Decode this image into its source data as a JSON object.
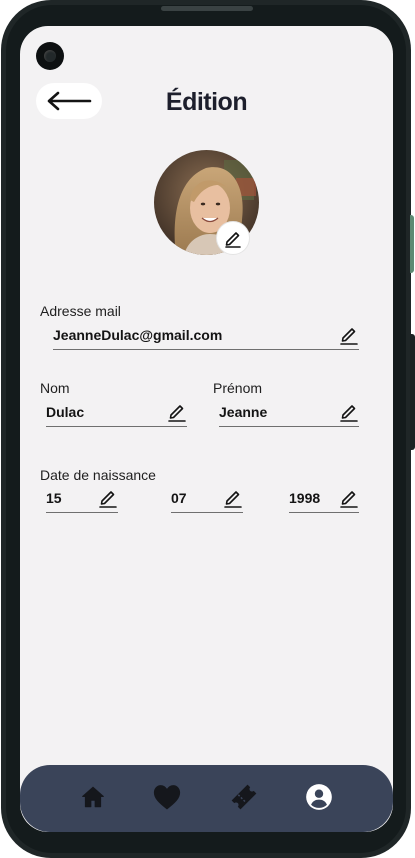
{
  "header": {
    "title": "Édition"
  },
  "icons": {
    "back": "arrow-left-icon",
    "edit": "pencil-icon",
    "home": "home-icon",
    "favorites": "heart-icon",
    "tickets": "ticket-icon",
    "profile": "user-circle-icon"
  },
  "profile": {
    "photo_alt": "Photo de profil"
  },
  "form": {
    "email": {
      "label": "Adresse mail",
      "value": "JeanneDulac@gmail.com"
    },
    "last_name": {
      "label": "Nom",
      "value": "Dulac"
    },
    "first_name": {
      "label": "Prénom",
      "value": "Jeanne"
    },
    "birth_date": {
      "label": "Date de naissance",
      "day": "15",
      "month": "07",
      "year": "1998"
    }
  },
  "colors": {
    "background": "#f3f2f3",
    "nav": "#3a4459",
    "text": "#1d1f2c",
    "frame": "#1f2627"
  }
}
